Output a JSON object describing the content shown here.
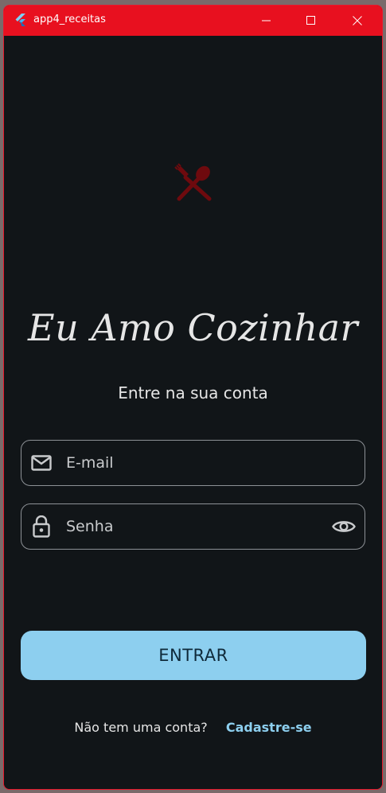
{
  "window": {
    "title": "app4_receitas",
    "icons": {
      "app": "flutter-icon",
      "minimize": "minimize-icon",
      "maximize": "maximize-icon",
      "close": "close-icon"
    }
  },
  "login": {
    "logo_icon": "fork-spoon-icon",
    "title": "Eu Amo Cozinhar",
    "subtitle": "Entre na sua conta",
    "email": {
      "placeholder": "E-mail",
      "value": "",
      "icon": "mail-icon"
    },
    "password": {
      "placeholder": "Senha",
      "value": "",
      "icon": "lock-icon",
      "toggle_icon": "eye-icon"
    },
    "submit_label": "ENTRAR",
    "signup_question": "Não tem uma conta?",
    "signup_link": "Cadastre-se"
  },
  "colors": {
    "titlebar": "#e8101f",
    "background": "#111518",
    "accent": "#8dcfef",
    "logo": "#6e0a0e",
    "text": "#e6e6e6"
  }
}
